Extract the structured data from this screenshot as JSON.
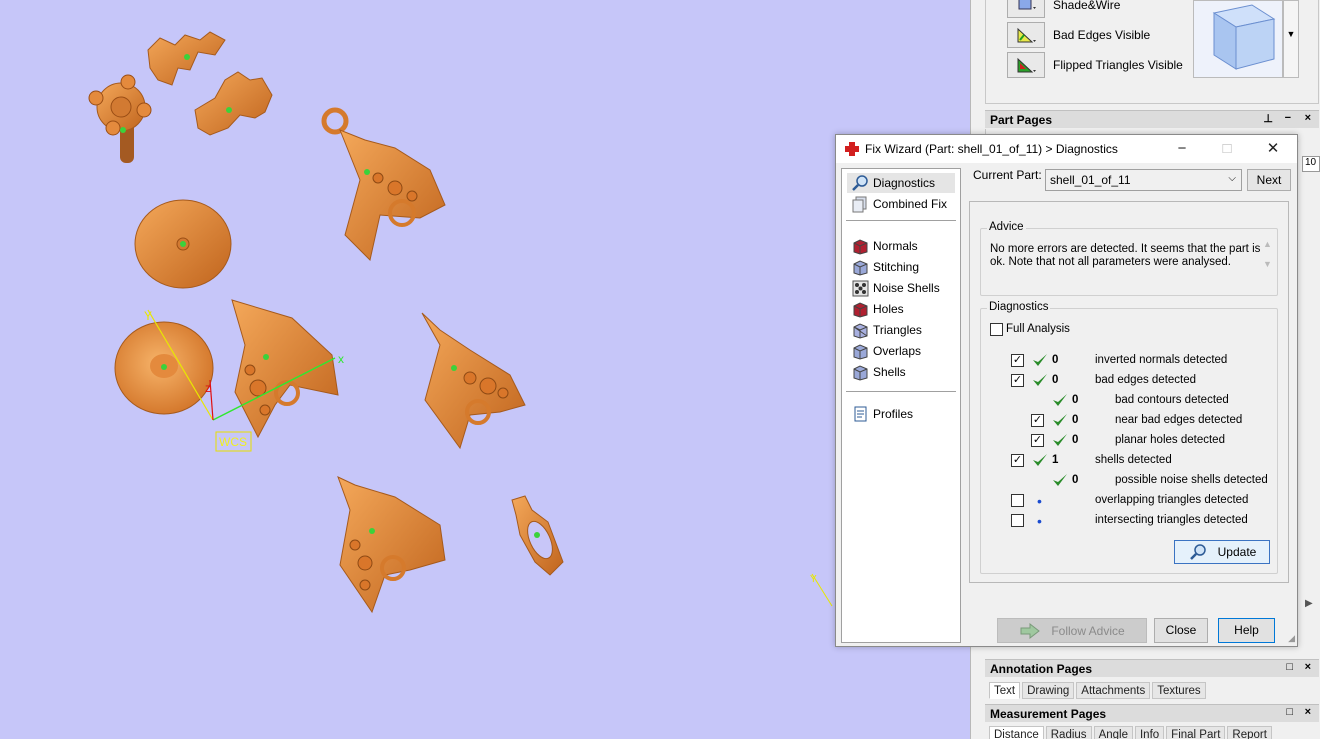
{
  "viewport": {
    "wcs_label": "WCS",
    "axis_x": "x",
    "axis_y": "Y",
    "axis_z": "z",
    "corner_axis_y": "Y"
  },
  "render_modes": [
    {
      "label": "Shade&Wire",
      "icon": "shade-wire-icon"
    },
    {
      "label": "Bad Edges Visible",
      "icon": "bad-edges-icon"
    },
    {
      "label": "Flipped Triangles Visible",
      "icon": "flipped-triangles-icon"
    }
  ],
  "part_pages": {
    "title": "Part Pages",
    "partial_tab": "s",
    "partial_value": "10"
  },
  "annotation_pages": {
    "title": "Annotation Pages",
    "tabs": [
      "Text",
      "Drawing",
      "Attachments",
      "Textures"
    ],
    "active": "Text"
  },
  "measurement_pages": {
    "title": "Measurement Pages",
    "tabs": [
      "Distance",
      "Radius",
      "Angle",
      "Info",
      "Final Part",
      "Report"
    ],
    "active": "Distance"
  },
  "dialog": {
    "title": "Fix Wizard (Part: shell_01_of_11) > Diagnostics",
    "nav": {
      "group1": [
        "Diagnostics",
        "Combined Fix"
      ],
      "group2": [
        "Normals",
        "Stitching",
        "Noise Shells",
        "Holes",
        "Triangles",
        "Overlaps",
        "Shells"
      ],
      "group3": [
        "Profiles"
      ]
    },
    "current_part_label": "Current Part:",
    "current_part_value": "shell_01_of_11",
    "next_label": "Next",
    "advice_title": "Advice",
    "advice_text": "No more errors are detected. It seems that the part is ok. Note that not all parameters were analysed.",
    "diagnostics_title": "Diagnostics",
    "full_analysis_label": "Full Analysis",
    "rows": [
      {
        "checked": true,
        "status": "ok",
        "count": "0",
        "label": "inverted normals detected",
        "indent": 0
      },
      {
        "checked": true,
        "status": "ok",
        "count": "0",
        "label": "bad edges detected",
        "indent": 0
      },
      {
        "checked": null,
        "status": "ok",
        "count": "0",
        "label": "bad contours detected",
        "indent": 1
      },
      {
        "checked": true,
        "status": "ok",
        "count": "0",
        "label": "near bad edges detected",
        "indent": 1
      },
      {
        "checked": true,
        "status": "ok",
        "count": "0",
        "label": "planar holes detected",
        "indent": 1
      },
      {
        "checked": true,
        "status": "ok",
        "count": "1",
        "label": "shells detected",
        "indent": 0
      },
      {
        "checked": null,
        "status": "ok",
        "count": "0",
        "label": "possible noise shells detected",
        "indent": 1
      },
      {
        "checked": false,
        "status": "pending",
        "count": "",
        "label": "overlapping triangles detected",
        "indent": 0
      },
      {
        "checked": false,
        "status": "pending",
        "count": "",
        "label": "intersecting triangles detected",
        "indent": 0
      }
    ],
    "update_label": "Update",
    "follow_advice_label": "Follow Advice",
    "close_label": "Close",
    "help_label": "Help"
  },
  "colors": {
    "viewport_bg": "#c6c6f9",
    "part_orange": "#e8893a",
    "check_green": "#2a8c2a"
  }
}
